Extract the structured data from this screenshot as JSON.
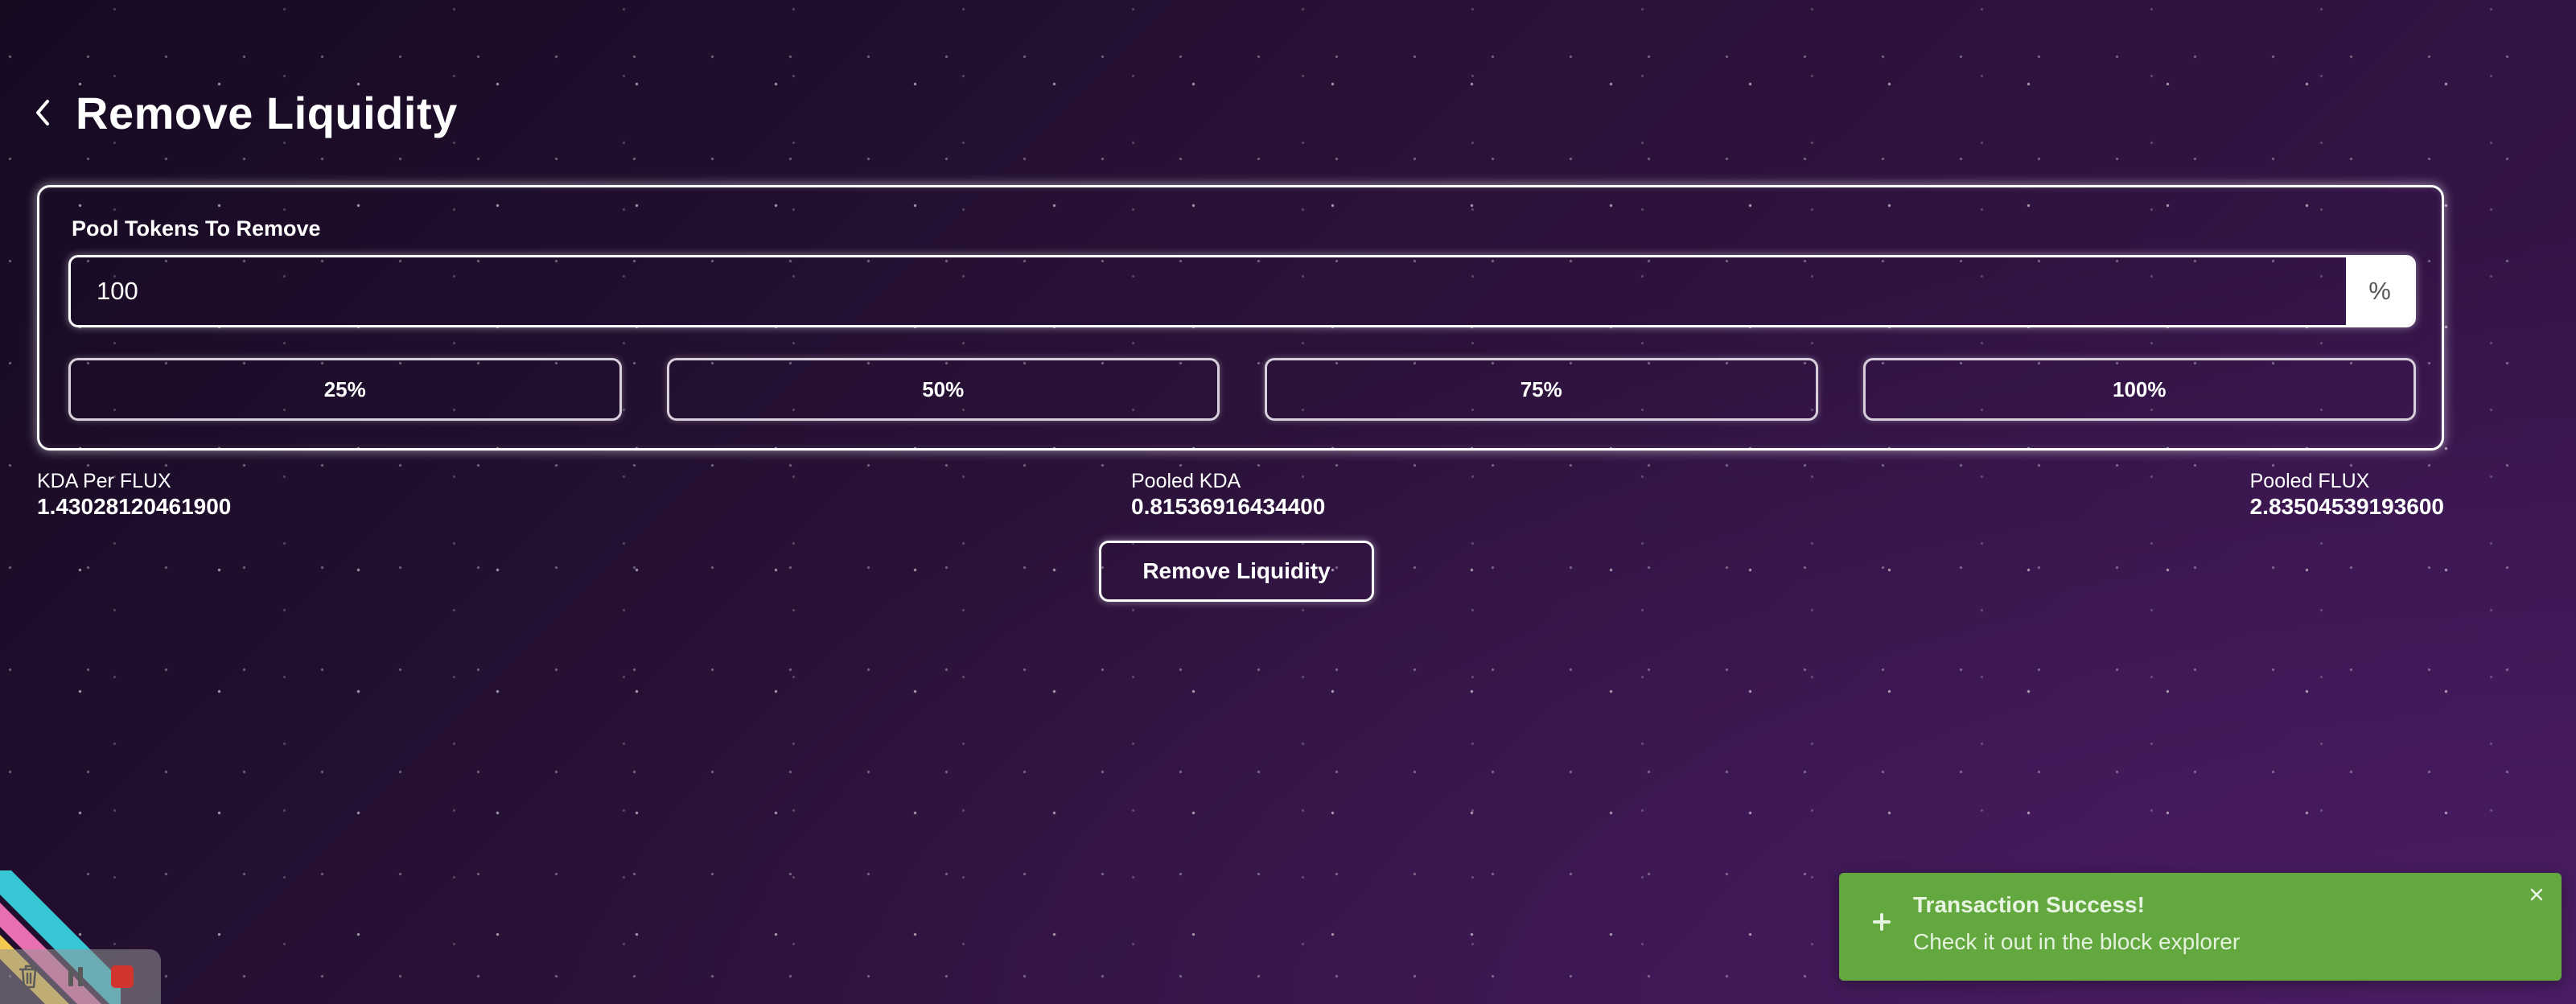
{
  "header": {
    "back_icon": "chevron-left-icon",
    "title": "Remove Liquidity"
  },
  "form": {
    "label": "Pool Tokens To Remove",
    "amount_value": "100",
    "amount_suffix": "%",
    "quick_options": [
      "25%",
      "50%",
      "75%",
      "100%"
    ]
  },
  "stats": [
    {
      "label": "KDA Per FLUX",
      "value": "1.43028120461900"
    },
    {
      "label": "Pooled KDA",
      "value": "0.81536916434400"
    },
    {
      "label": "Pooled FLUX",
      "value": "2.83504539193600"
    }
  ],
  "submit_label": "Remove Liquidity",
  "toast": {
    "title": "Transaction Success!",
    "message": "Check it out in the block explorer",
    "background": "#62a83f",
    "icon": "plus-icon",
    "close_icon": "close-icon"
  },
  "recorder": {
    "controls": [
      "trash-icon",
      "pause-icon",
      "stop-icon"
    ],
    "stop_color": "#d0352f"
  },
  "colors": {
    "background_dark": "#160a21",
    "background_light": "#4a1d63",
    "outline": "#ffffff"
  }
}
